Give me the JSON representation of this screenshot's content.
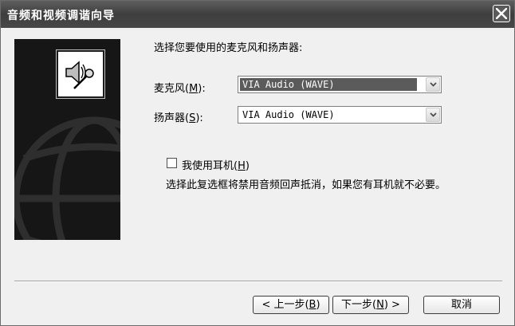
{
  "window": {
    "title": "音频和视频调谐向导"
  },
  "heading": "选择您要使用的麦克风和扬声器:",
  "microphone": {
    "label_prefix": "麦克风(",
    "label_key": "M",
    "label_suffix": "):",
    "value": "VIA Audio (WAVE)"
  },
  "speaker": {
    "label_prefix": "扬声器(",
    "label_key": "S",
    "label_suffix": "):",
    "value": "VIA Audio (WAVE)"
  },
  "headphones": {
    "label_prefix": "我使用耳机(",
    "label_key": "H",
    "label_suffix": ")",
    "checked": false
  },
  "description": "选择此复选框将禁用音频回声抵消，如果您有耳机就不必要。",
  "buttons": {
    "back_prefix": "< 上一步(",
    "back_key": "B",
    "back_suffix": ")",
    "next_prefix": "下一步(",
    "next_key": "N",
    "next_suffix": ") >",
    "cancel": "取消"
  },
  "icons": {
    "close": "close-icon",
    "speaker_mic": "speaker-microphone-icon",
    "dropdown": "chevron-down-icon",
    "side_art": "globe-art"
  }
}
